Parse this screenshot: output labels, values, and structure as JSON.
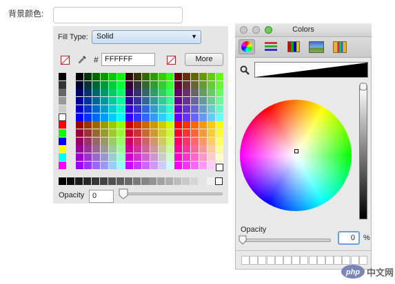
{
  "form": {
    "bg_color_label": "背景颜色:",
    "bg_color_value": ""
  },
  "fill_panel": {
    "fill_type_label": "Fill Type:",
    "fill_type_value": "Solid",
    "hash_symbol": "#",
    "hex_value": "FFFFFF",
    "more_button": "More",
    "opacity_label": "Opacity",
    "opacity_value": "0",
    "swatch_colors": {
      "accent_red": "#cc0000"
    }
  },
  "colors_window": {
    "title": "Colors",
    "toolbar_tools": [
      {
        "name": "color-wheel-icon",
        "selected": true
      },
      {
        "name": "color-sliders-icon",
        "selected": false
      },
      {
        "name": "color-palettes-icon",
        "selected": false
      },
      {
        "name": "image-palettes-icon",
        "selected": false
      },
      {
        "name": "crayons-icon",
        "selected": false
      }
    ],
    "opacity_label": "Opacity",
    "opacity_value": "0",
    "percent_symbol": "%"
  },
  "watermark": {
    "logo_text": "php",
    "site_text": "中文网"
  }
}
